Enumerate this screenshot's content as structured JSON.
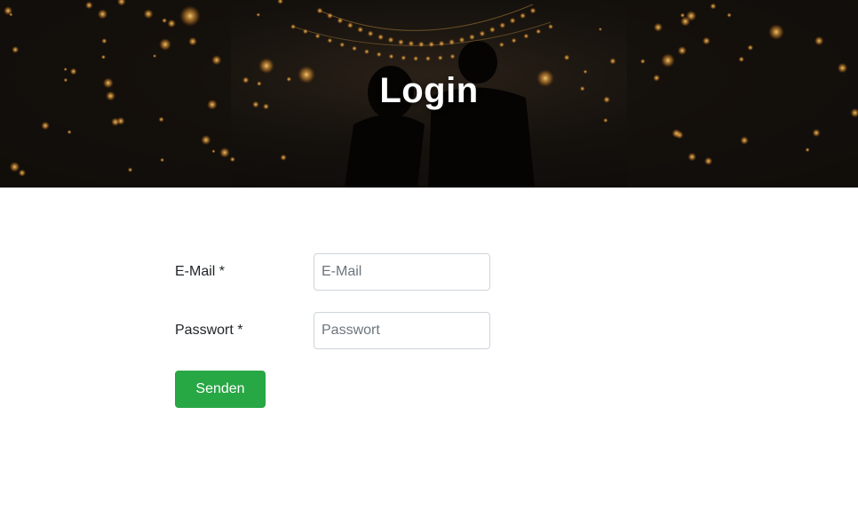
{
  "hero": {
    "title": "Login"
  },
  "form": {
    "email": {
      "label": "E-Mail *",
      "placeholder": "E-Mail",
      "value": ""
    },
    "password": {
      "label": "Passwort *",
      "placeholder": "Passwort",
      "value": ""
    },
    "submit_label": "Senden"
  },
  "colors": {
    "accent": "#28a745",
    "hero_dark": "#0b0908",
    "bokeh": "#e0a040"
  }
}
